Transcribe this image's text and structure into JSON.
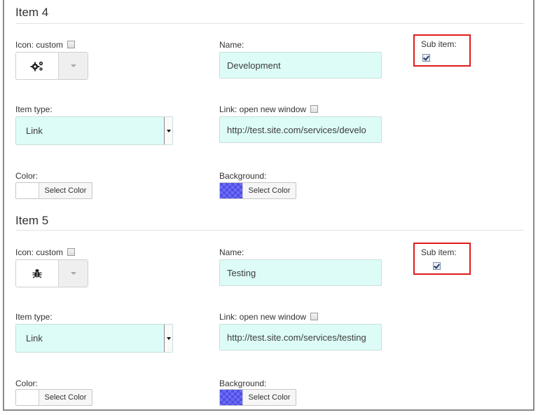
{
  "item4": {
    "title": "Item 4",
    "icon_label": "Icon: custom",
    "icon_name": "gears-icon",
    "name_label": "Name:",
    "name_value": "Development",
    "sub_item_label": "Sub item:",
    "sub_item_checked": true,
    "item_type_label": "Item type:",
    "item_type_value": "Link",
    "link_label": "Link: open new window",
    "link_value": "http://test.site.com/services/develo",
    "color_label": "Color:",
    "color_button": "Select Color",
    "background_label": "Background:",
    "background_button": "Select Color"
  },
  "item5": {
    "title": "Item 5",
    "icon_label": "Icon: custom",
    "icon_name": "bug-icon",
    "name_label": "Name:",
    "name_value": "Testing",
    "sub_item_label": "Sub item:",
    "sub_item_checked": true,
    "item_type_label": "Item type:",
    "item_type_value": "Link",
    "link_label": "Link: open new window",
    "link_value": "http://test.site.com/services/testing",
    "color_label": "Color:",
    "color_button": "Select Color",
    "background_label": "Background:",
    "background_button": "Select Color"
  },
  "colors": {
    "field_bg": "#ddfcf7",
    "highlight_border": "#e01b1b",
    "background_swatch": "#4f4fe6"
  }
}
